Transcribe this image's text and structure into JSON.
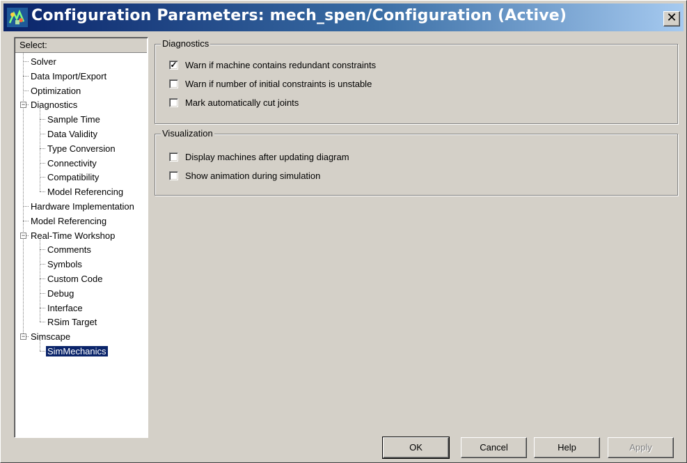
{
  "window": {
    "title": "Configuration Parameters: mech_spen/Configuration (Active)",
    "close_glyph": "✕"
  },
  "tree": {
    "header": "Select:",
    "items": [
      {
        "label": "Solver",
        "level": 0
      },
      {
        "label": "Data Import/Export",
        "level": 0
      },
      {
        "label": "Optimization",
        "level": 0
      },
      {
        "label": "Diagnostics",
        "level": 0,
        "expanded": true
      },
      {
        "label": "Sample Time",
        "level": 1
      },
      {
        "label": "Data Validity",
        "level": 1
      },
      {
        "label": "Type Conversion",
        "level": 1
      },
      {
        "label": "Connectivity",
        "level": 1
      },
      {
        "label": "Compatibility",
        "level": 1
      },
      {
        "label": "Model Referencing",
        "level": 1
      },
      {
        "label": "Hardware Implementation",
        "level": 0
      },
      {
        "label": "Model Referencing",
        "level": 0
      },
      {
        "label": "Real-Time Workshop",
        "level": 0,
        "expanded": true
      },
      {
        "label": "Comments",
        "level": 1
      },
      {
        "label": "Symbols",
        "level": 1
      },
      {
        "label": "Custom Code",
        "level": 1
      },
      {
        "label": "Debug",
        "level": 1
      },
      {
        "label": "Interface",
        "level": 1
      },
      {
        "label": "RSim Target",
        "level": 1
      },
      {
        "label": "Simscape",
        "level": 0,
        "expanded": true
      },
      {
        "label": "SimMechanics",
        "level": 1,
        "selected": true
      }
    ]
  },
  "diagnostics": {
    "title": "Diagnostics",
    "options": [
      {
        "label": "Warn if machine contains redundant constraints",
        "checked": true
      },
      {
        "label": "Warn if number of initial constraints is unstable",
        "checked": false
      },
      {
        "label": "Mark automatically cut joints",
        "checked": false
      }
    ]
  },
  "visualization": {
    "title": "Visualization",
    "options": [
      {
        "label": "Display machines after updating diagram",
        "checked": false
      },
      {
        "label": "Show animation during simulation",
        "checked": false
      }
    ]
  },
  "buttons": {
    "ok": "OK",
    "cancel": "Cancel",
    "help": "Help",
    "apply": "Apply"
  },
  "colors": {
    "titlebar_start": "#0a246a",
    "titlebar_end": "#a6caf0",
    "face": "#d4d0c8",
    "selection": "#0a246a"
  }
}
